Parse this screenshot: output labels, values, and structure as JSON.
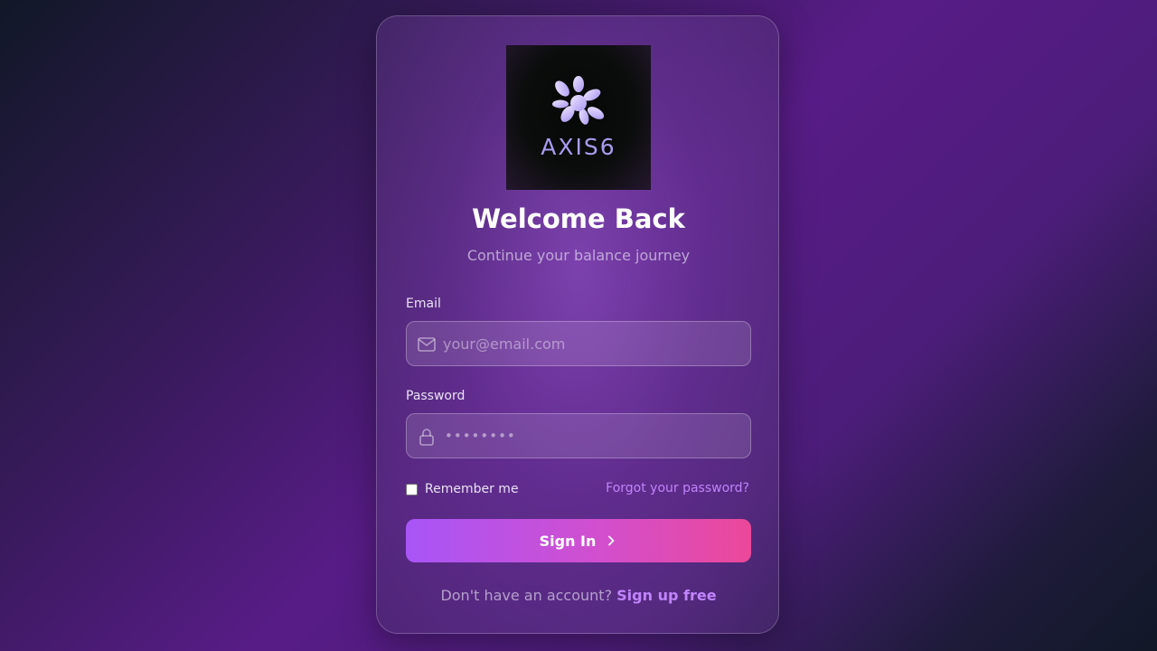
{
  "brand": {
    "logo_text": "AXIS6",
    "logo_icon": "six-petal-flower-icon",
    "accent_color": "#a89cf0"
  },
  "header": {
    "title": "Welcome Back",
    "subtitle": "Continue your balance journey"
  },
  "form": {
    "email": {
      "label": "Email",
      "placeholder": "your@email.com",
      "value": "",
      "icon": "mail-icon"
    },
    "password": {
      "label": "Password",
      "masked_value": "••••••••",
      "icon": "lock-icon"
    },
    "remember_label": "Remember me",
    "remember_checked": false,
    "forgot_label": "Forgot your password?",
    "submit_label": "Sign In",
    "submit_icon": "chevron-right-icon"
  },
  "footer": {
    "prompt": "Don't have an account?",
    "signup_label": "Sign up free"
  },
  "colors": {
    "link": "#c084fc",
    "button_start": "#a855f7",
    "button_end": "#ec4899"
  }
}
